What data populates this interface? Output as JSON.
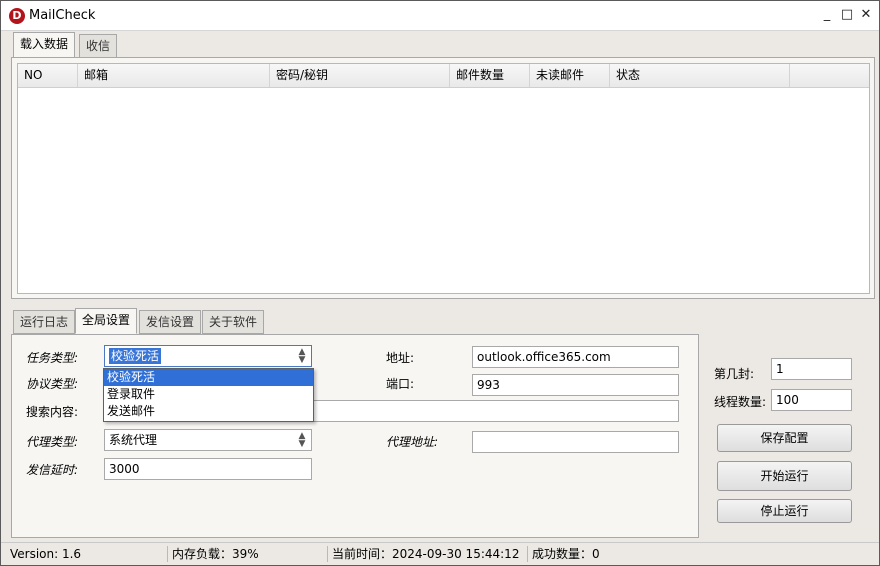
{
  "window": {
    "title": "MailCheck",
    "icon_letter": "D",
    "min": "_",
    "max": "□",
    "close": "✕"
  },
  "top_tabs": [
    {
      "label": "载入数据",
      "active": true
    },
    {
      "label": "收信",
      "active": false
    }
  ],
  "grid": {
    "columns": [
      "NO",
      "邮箱",
      "密码/秘钥",
      "邮件数量",
      "未读邮件",
      "状态"
    ]
  },
  "bottom_tabs": [
    {
      "label": "运行日志",
      "active": false
    },
    {
      "label": "全局设置",
      "active": true
    },
    {
      "label": "发信设置",
      "active": false
    },
    {
      "label": "关于软件",
      "active": false
    }
  ],
  "settings": {
    "task_type_label": "任务类型:",
    "task_type_value": "校验死活",
    "task_type_options": [
      "校验死活",
      "登录取件",
      "发送邮件"
    ],
    "protocol_label": "协议类型:",
    "search_label": "搜索内容:",
    "search_value": "",
    "proxy_type_label": "代理类型:",
    "proxy_type_value": "系统代理",
    "send_delay_label": "发信延时:",
    "send_delay_value": "3000",
    "address_label": "地址:",
    "address_value": "outlook.office365.com",
    "port_label": "端口:",
    "port_value": "993",
    "proxy_addr_label": "代理地址:",
    "proxy_addr_value": ""
  },
  "right_panel": {
    "nth_label": "第几封:",
    "nth_value": "1",
    "threads_label": "线程数量:",
    "threads_value": "100",
    "save_button": "保存配置",
    "start_button": "开始运行",
    "stop_button": "停止运行"
  },
  "statusbar": {
    "version": "Version:  1.6",
    "memory": "内存负载：39%",
    "time": "当前时间：2024-09-30 15:44:12",
    "success": "成功数量：0"
  }
}
